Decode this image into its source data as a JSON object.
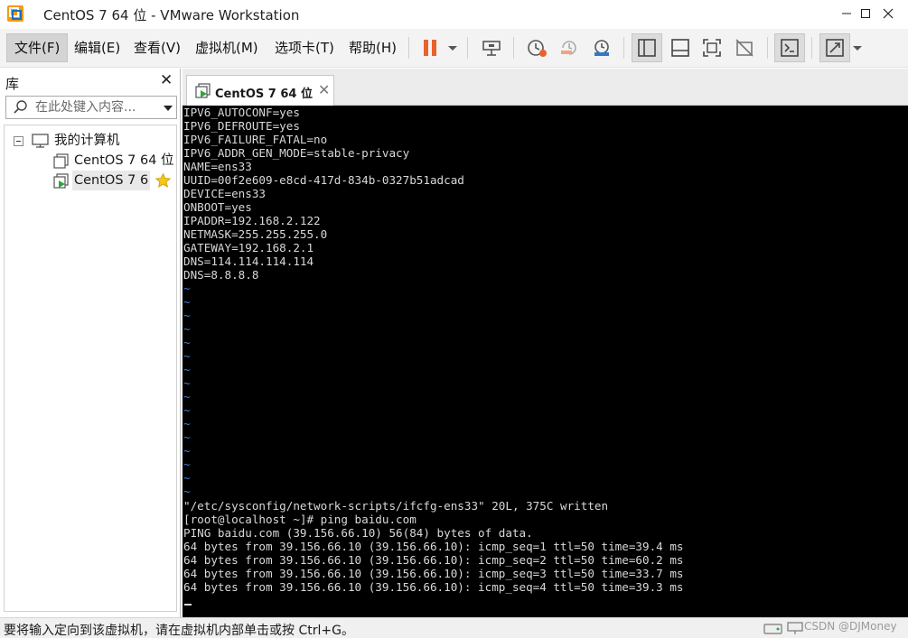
{
  "window": {
    "title": "CentOS 7 64 位 - VMware Workstation",
    "icons": [
      "vmware-logo",
      "minimize-icon",
      "maximize-icon",
      "close-icon"
    ]
  },
  "menu": {
    "items": [
      {
        "label": "文件(F)",
        "active": true
      },
      {
        "label": "编辑(E)"
      },
      {
        "label": "查看(V)"
      },
      {
        "label": "虚拟机(M)"
      },
      {
        "label": "选项卡(T)"
      },
      {
        "label": "帮助(H)"
      }
    ]
  },
  "toolbar": {
    "icons": [
      "pause-icon",
      "send-ctrl-alt-del-icon",
      "snapshot-icon",
      "revert-snapshot-icon",
      "snapshot-manager-icon",
      "show-library-icon",
      "thumbnail-bar-icon",
      "full-screen-icon",
      "unity-icon",
      "console-view-icon",
      "stretch-guest-icon"
    ],
    "accent_color": "#e8632b"
  },
  "library": {
    "title": "库",
    "close_symbol": "✕",
    "search_placeholder": "在此处键入内容...",
    "tree": {
      "root": "我的计算机",
      "items": [
        {
          "label": "CentOS 7 64 位",
          "icon": "vm-icon",
          "running": false
        },
        {
          "label": "CentOS 7 6",
          "icon": "vm-running-icon",
          "running": true,
          "selected": true,
          "favorite": true
        }
      ]
    }
  },
  "tab": {
    "label": "CentOS 7 64 位",
    "close_symbol": "✕"
  },
  "console": {
    "config_lines": [
      "IPV6_AUTOCONF=yes",
      "IPV6_DEFROUTE=yes",
      "IPV6_FAILURE_FATAL=no",
      "IPV6_ADDR_GEN_MODE=stable-privacy",
      "NAME=ens33",
      "UUID=00f2e609-e8cd-417d-834b-0327b51adcad",
      "DEVICE=ens33",
      "ONBOOT=yes",
      "IPADDR=192.168.2.122",
      "NETMASK=255.255.255.0",
      "GATEWAY=192.168.2.1",
      "DNS=114.114.114.114",
      "DNS=8.8.8.8"
    ],
    "tilde": "~",
    "tilde_count": 16,
    "output_lines": [
      "\"/etc/sysconfig/network-scripts/ifcfg-ens33\" 20L, 375C written",
      "[root@localhost ~]# ping baidu.com",
      "PING baidu.com (39.156.66.10) 56(84) bytes of data.",
      "64 bytes from 39.156.66.10 (39.156.66.10): icmp_seq=1 ttl=50 time=39.4 ms",
      "64 bytes from 39.156.66.10 (39.156.66.10): icmp_seq=2 ttl=50 time=60.2 ms",
      "64 bytes from 39.156.66.10 (39.156.66.10): icmp_seq=3 ttl=50 time=33.7 ms",
      "64 bytes from 39.156.66.10 (39.156.66.10): icmp_seq=4 ttl=50 time=39.3 ms"
    ]
  },
  "status": {
    "text": "要将输入定向到该虚拟机，请在虚拟机内部单击或按 Ctrl+G。",
    "watermark": "CSDN @DJMoney",
    "icons": [
      "hard-disk-icon",
      "network-icon"
    ]
  }
}
